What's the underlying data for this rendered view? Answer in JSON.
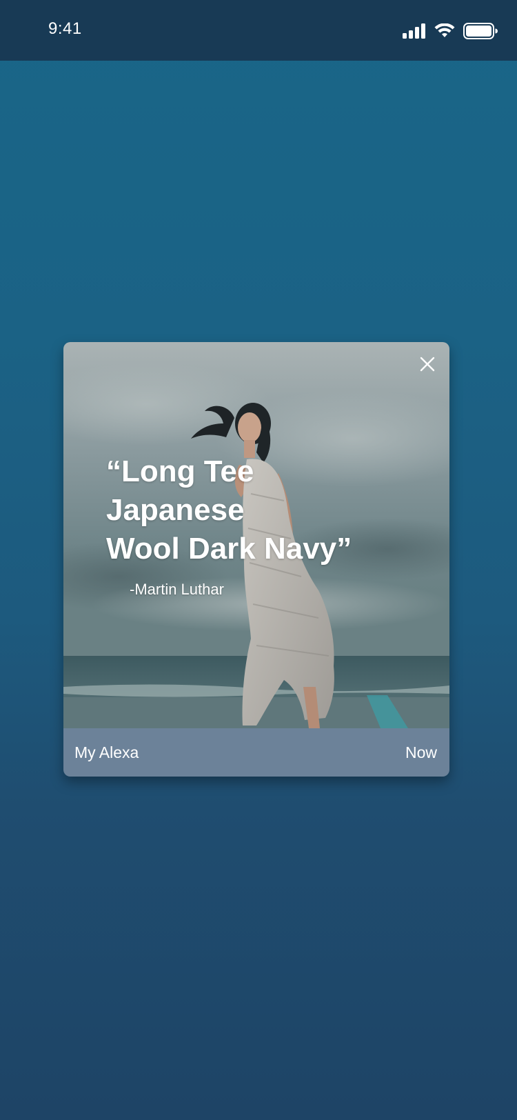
{
  "status_bar": {
    "time": "9:41",
    "icons": [
      "cellular-signal-icon",
      "wifi-icon",
      "battery-icon"
    ]
  },
  "notification": {
    "quote_lines": [
      "“Long Tee",
      "Japanese",
      "Wool Dark Navy”"
    ],
    "author": "-Martin Luthar",
    "app_name": "My Alexa",
    "timestamp": "Now",
    "close_icon": "close-icon",
    "footer_color": "#6c8299"
  },
  "colors": {
    "status_bar_bg": "#183a55",
    "background_top": "#196688",
    "background_bottom": "#1e4466"
  }
}
